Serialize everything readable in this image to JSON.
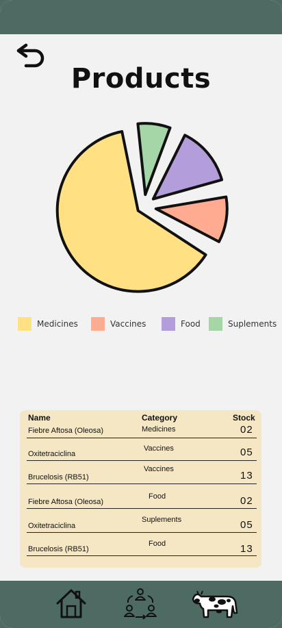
{
  "page": {
    "title": "Products"
  },
  "chart_data": {
    "type": "pie",
    "legend": [
      "Medicines",
      "Vaccines",
      "Food",
      "Suplements"
    ],
    "values": [
      64,
      12,
      15,
      9
    ],
    "colors": [
      "#ffe083",
      "#ffab91",
      "#b39ddb",
      "#a5d6a7"
    ],
    "legend_placement": "bottom",
    "exploded": true
  },
  "legend": [
    {
      "label": "Medicines",
      "color": "#ffe083"
    },
    {
      "label": "Vaccines",
      "color": "#ffab91"
    },
    {
      "label": "Food",
      "color": "#b39ddb"
    },
    {
      "label": "Suplements",
      "color": "#a5d6a7"
    }
  ],
  "table": {
    "headers": {
      "name": "Name",
      "category": "Category",
      "stock": "Stock"
    },
    "rows": [
      {
        "name": "Fiebre Aftosa (Oleosa)",
        "category": "Medicines",
        "stock": "02"
      },
      {
        "name": "Oxitetraciclina",
        "category": "Vaccines",
        "stock": "05"
      },
      {
        "name": "Brucelosis (RB51)",
        "category": "Vaccines",
        "stock": "13"
      },
      {
        "name": "Fiebre Aftosa (Oleosa)",
        "category": "Food",
        "stock": "02"
      },
      {
        "name": "Oxitetraciclina",
        "category": "Suplements",
        "stock": "05"
      },
      {
        "name": "Brucelosis (RB51)",
        "category": "Food",
        "stock": "13"
      }
    ]
  },
  "nav": {
    "icons": [
      "home-icon",
      "users-exchange-icon",
      "cow-icon"
    ]
  },
  "colors": {
    "bar": "#4d6b63",
    "background": "#f2f2f2",
    "table_bg": "#f5e6c4"
  }
}
